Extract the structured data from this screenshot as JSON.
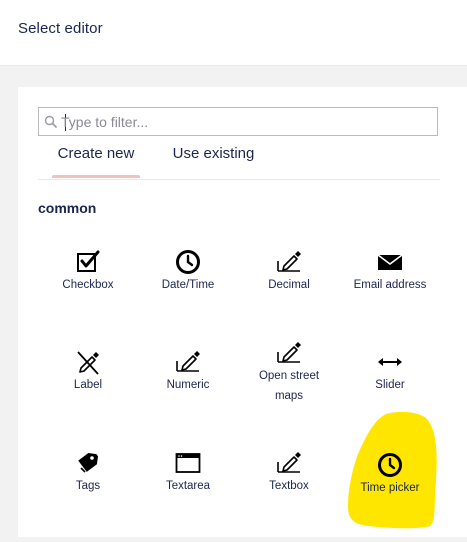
{
  "header": {
    "title": "Select editor"
  },
  "search": {
    "placeholder": "Type to filter...",
    "value": ""
  },
  "tabs": [
    {
      "label": "Create new",
      "active": true
    },
    {
      "label": "Use existing",
      "active": false
    }
  ],
  "section": {
    "title": "common"
  },
  "editors": [
    {
      "label": "Checkbox",
      "icon": "checkbox-icon"
    },
    {
      "label": "Date/Time",
      "icon": "clock-icon"
    },
    {
      "label": "Decimal",
      "icon": "pen-icon"
    },
    {
      "label": "Email address",
      "icon": "envelope-icon"
    },
    {
      "label": "Label",
      "icon": "pen-crossed-icon"
    },
    {
      "label": "Numeric",
      "icon": "pen-icon"
    },
    {
      "label": "Open street maps",
      "icon": "pen-icon"
    },
    {
      "label": "Slider",
      "icon": "arrows-horizontal-icon"
    },
    {
      "label": "Tags",
      "icon": "tag-icon"
    },
    {
      "label": "Textarea",
      "icon": "window-icon"
    },
    {
      "label": "Textbox",
      "icon": "pen-icon"
    },
    {
      "label": "Time picker",
      "icon": "clock-icon",
      "highlighted": true
    }
  ],
  "colors": {
    "text": "#1b264f",
    "accent_tab": "#f5c1bc",
    "highlight": "#ffe600"
  }
}
